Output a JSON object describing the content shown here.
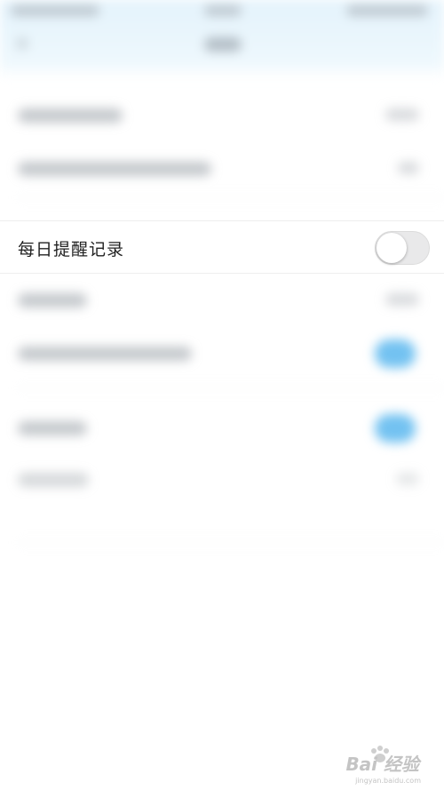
{
  "settings": {
    "daily_reminder_label": "每日提醒记录",
    "daily_reminder_enabled": false
  },
  "watermark": {
    "brand": "Bai 经验",
    "url": "jingyan.baidu.com"
  },
  "colors": {
    "header_bg": "#e4f3fc",
    "toggle_on": "#5ab7ef",
    "toggle_off": "#e9e9ea"
  }
}
